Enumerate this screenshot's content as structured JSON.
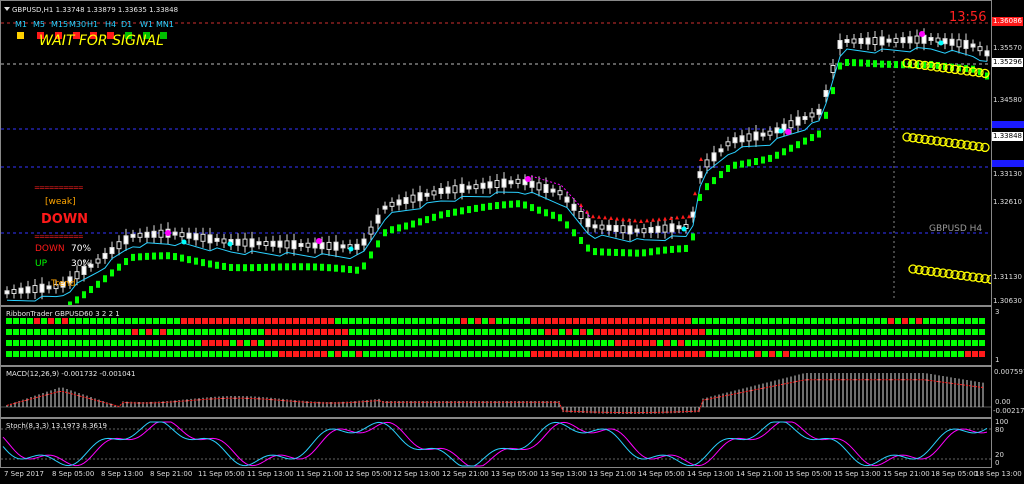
{
  "header": {
    "symbol_line": "GBPUSD,H1  1.33748 1.33879 1.33635 1.33848",
    "clock": "13:56"
  },
  "timeframes": [
    {
      "label": "M1",
      "color": "#ffd000"
    },
    {
      "label": "M5",
      "color": "#ff1a1a"
    },
    {
      "label": "M15",
      "color": "#ff1a1a"
    },
    {
      "label": "M30",
      "color": "#ff1a1a"
    },
    {
      "label": "H1",
      "color": "#ff1a1a"
    },
    {
      "label": "H4",
      "color": "#ff1a1a"
    },
    {
      "label": "D1",
      "color": "#00c000"
    },
    {
      "label": "W1",
      "color": "#00c000"
    },
    {
      "label": "MN1",
      "color": "#00c000"
    }
  ],
  "signal": "WAIT FOR SIGNAL",
  "panel": {
    "divider": "==========",
    "weak": "[weak]",
    "direction": "DOWN",
    "down_label": "DOWN",
    "down_val": "70%",
    "up_label": "UP",
    "up_val": "30%",
    "trend": "Trend"
  },
  "price_axis": {
    "labels": [
      "1.35570",
      "1.35296",
      "1.34580",
      "1.33848",
      "1.33130",
      "1.32610",
      "1.31130",
      "1.30630"
    ],
    "top_tag": "1.36086"
  },
  "symbol_tf": "GBPUSD H4",
  "indicators": {
    "ribbon": "RibbonTrader GBPUSD60 3 2 2 1",
    "macd": "MACD(12,26,9) -0.001732 -0.001041",
    "stoch": "Stoch(8,3,3) 13.1973 8.3619"
  },
  "ribbon_axis": [
    "3",
    "1"
  ],
  "macd_axis": [
    "0.007597",
    "0.00",
    "-0.002175"
  ],
  "stoch_axis": [
    "100",
    "80",
    "20",
    "0"
  ],
  "dates": [
    "7 Sep 2017",
    "8 Sep 05:00",
    "8 Sep 13:00",
    "8 Sep 21:00",
    "11 Sep 05:00",
    "11 Sep 13:00",
    "11 Sep 21:00",
    "12 Sep 05:00",
    "12 Sep 13:00",
    "12 Sep 21:00",
    "13 Sep 05:00",
    "13 Sep 13:00",
    "13 Sep 21:00",
    "14 Sep 05:00",
    "14 Sep 13:00",
    "14 Sep 21:00",
    "15 Sep 05:00",
    "15 Sep 13:00",
    "15 Sep 21:00",
    "18 Sep 05:00",
    "18 Sep 13:00"
  ],
  "colors": {
    "bull": "#00ff00",
    "bear": "#ff1a1a",
    "blue_line": "#2ad0ff",
    "magenta": "#ff00ff",
    "yellow": "#ffff00"
  }
}
